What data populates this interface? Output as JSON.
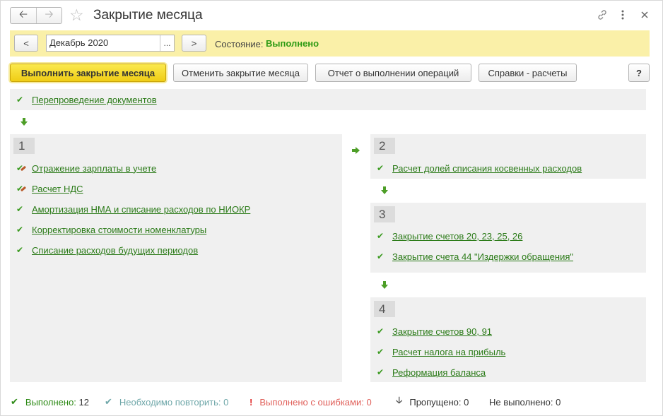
{
  "window": {
    "title": "Закрытие месяца"
  },
  "state_bar": {
    "prev_label": "<",
    "period_value": "Декабрь 2020",
    "period_select": "...",
    "next_label": ">",
    "state_label": "Состояние:",
    "state_value": "Выполнено"
  },
  "toolbar": {
    "run_label": "Выполнить закрытие месяца",
    "cancel_label": "Отменить закрытие месяца",
    "report_label": "Отчет о выполнении операций",
    "refs_label": "Справки - расчеты",
    "help_label": "?"
  },
  "prelim": {
    "items": [
      "Перепроведение документов"
    ]
  },
  "steps": [
    {
      "number": "1",
      "items": [
        "Отражение зарплаты в учете",
        "Расчет НДС",
        "Амортизация НМА и списание расходов по НИОКР",
        "Корректировка стоимости номенклатуры",
        "Списание расходов будущих периодов"
      ]
    },
    {
      "number": "2",
      "items": [
        "Расчет долей списания косвенных расходов"
      ]
    },
    {
      "number": "3",
      "items": [
        "Закрытие счетов 20, 23, 25, 26",
        "Закрытие счета 44 \"Издержки обращения\""
      ]
    },
    {
      "number": "4",
      "items": [
        "Закрытие счетов 90, 91",
        "Расчет налога на прибыль",
        "Реформация баланса"
      ]
    }
  ],
  "status": {
    "done_label": "Выполнено:",
    "done_count": "12",
    "repeat_label": "Необходимо повторить:",
    "repeat_count": "0",
    "errors_label": "Выполнено с ошибками:",
    "errors_count": "0",
    "skipped_label": "Пропущено:",
    "skipped_count": "0",
    "notdone_label": "Не выполнено:",
    "notdone_count": "0"
  },
  "colors": {
    "accent_green": "#2d9a13",
    "state_bg": "#faf0a8",
    "primary_button": "#f5d91e"
  }
}
